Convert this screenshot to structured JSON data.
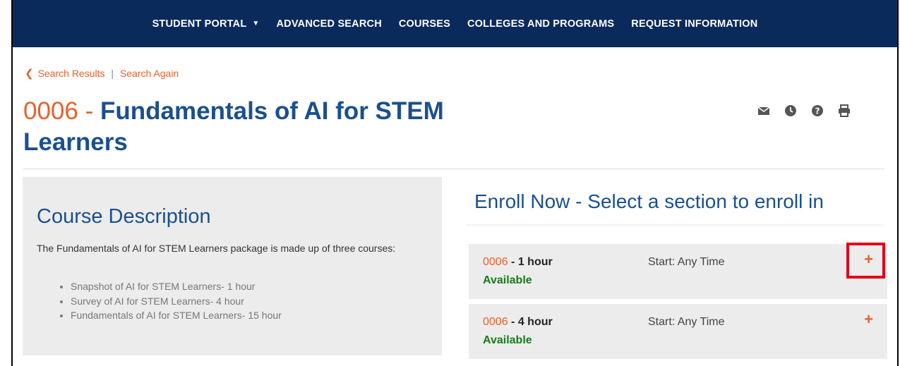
{
  "nav": {
    "items": [
      {
        "label": "STUDENT PORTAL",
        "has_dropdown": true
      },
      {
        "label": "ADVANCED SEARCH"
      },
      {
        "label": "COURSES"
      },
      {
        "label": "COLLEGES AND PROGRAMS"
      },
      {
        "label": "REQUEST INFORMATION"
      }
    ]
  },
  "breadcrumb": {
    "back_label": "Search Results",
    "separator": "|",
    "again_label": "Search Again"
  },
  "course": {
    "number": "0006",
    "dash": "-",
    "name_line1": "Fundamentals of AI for STEM",
    "name_line2": "Learners"
  },
  "action_icons": [
    "email-icon",
    "clock-icon",
    "help-icon",
    "print-icon"
  ],
  "description": {
    "heading": "Course Description",
    "intro": "The Fundamentals of AI for STEM Learners package is made up of three courses:",
    "items": [
      "Snapshot of AI for STEM Learners- 1 hour",
      "Survey of AI for STEM Learners- 4 hour",
      "Fundamentals of AI for STEM Learners- 15 hour"
    ]
  },
  "enroll": {
    "heading": "Enroll Now - Select a section to enroll in",
    "sections": [
      {
        "number": "0006",
        "hours": "- 1 hour",
        "status": "Available",
        "start": "Start: Any Time",
        "action": "+"
      },
      {
        "number": "0006",
        "hours": "- 4 hour",
        "status": "Available",
        "start": "Start: Any Time",
        "action": "+"
      }
    ]
  },
  "colors": {
    "nav_bg": "#0b2a5c",
    "accent": "#e8602c",
    "title": "#1b4f8f",
    "available": "#1a7a1a",
    "highlight": "#e0001b"
  }
}
